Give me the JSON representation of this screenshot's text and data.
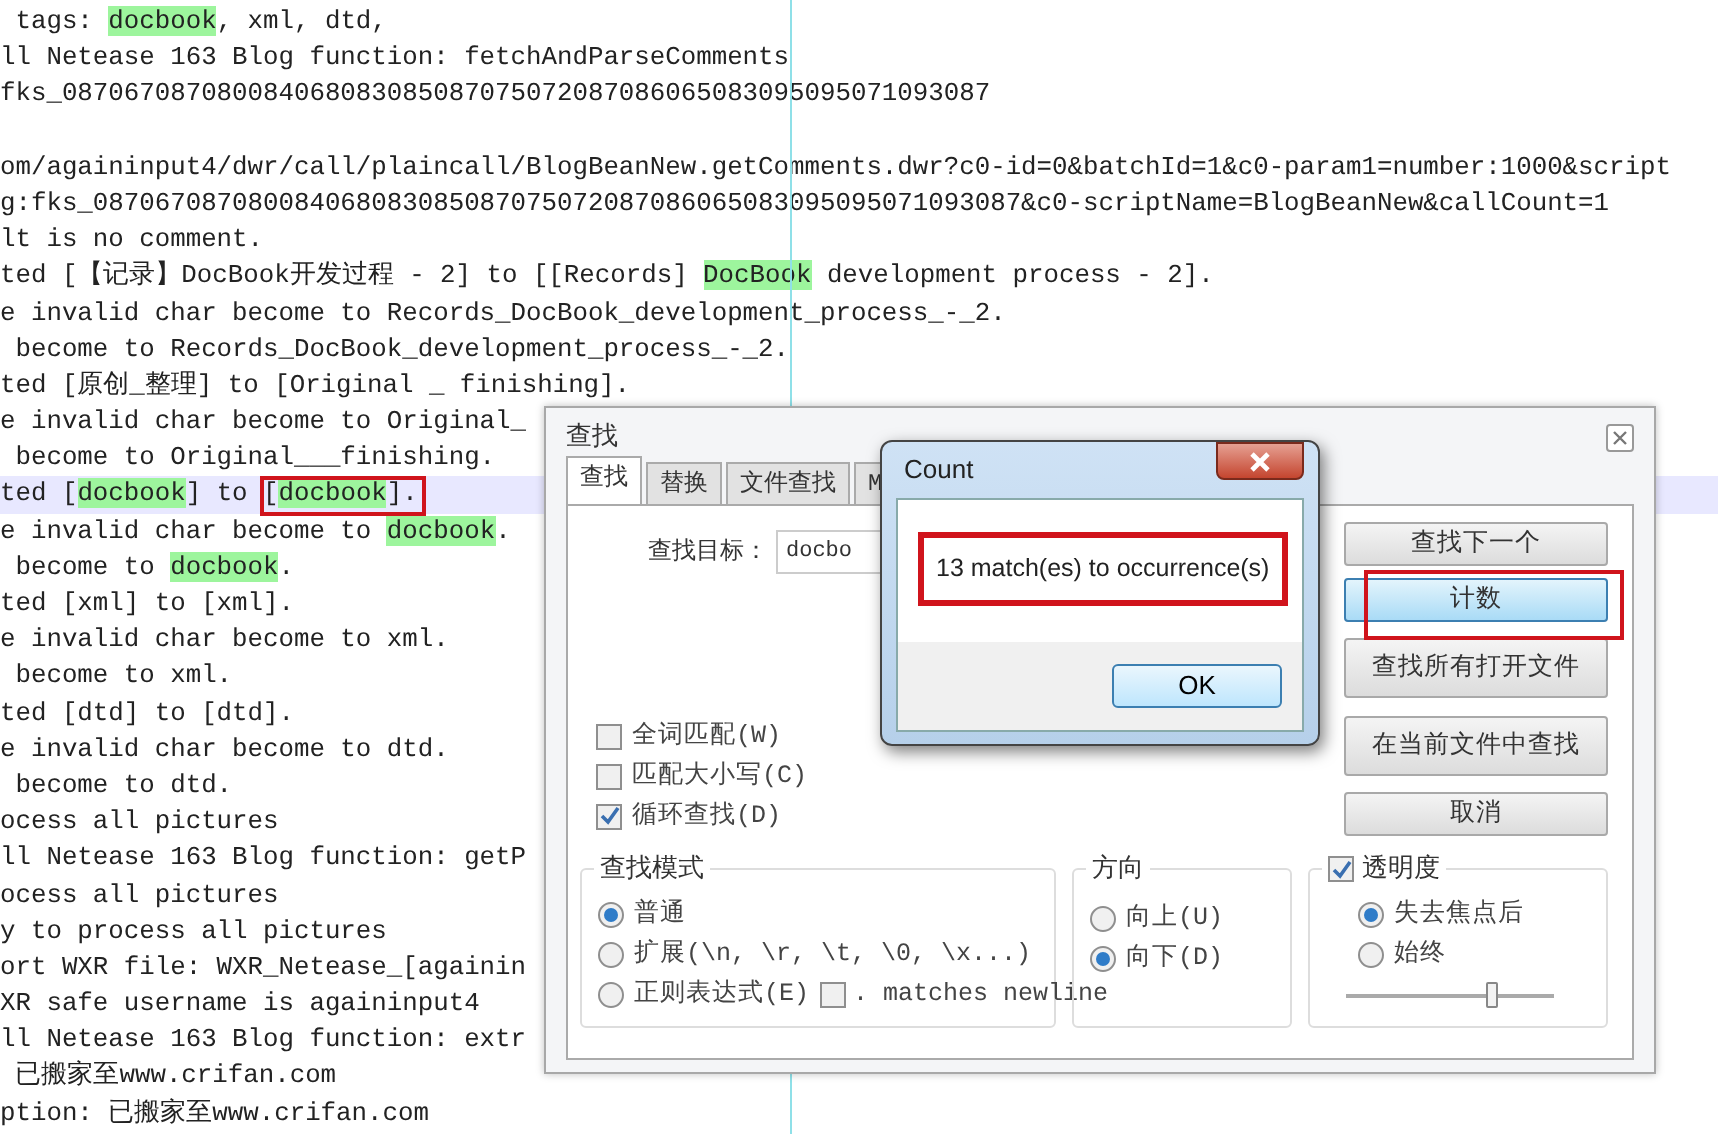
{
  "editor": {
    "lines": [
      {
        "segments": [
          {
            "text": " tags: ",
            "match": false
          },
          {
            "text": "docbook",
            "match": true
          },
          {
            "text": ", xml, dtd,",
            "match": false
          }
        ],
        "current": false
      },
      {
        "segments": [
          {
            "text": "ll Netease 163 Blog function: fetchAndParseComments",
            "match": false
          }
        ],
        "current": false
      },
      {
        "segments": [
          {
            "text": "fks_087067087080084068083085087075072087086065083095095071093087",
            "match": false
          }
        ],
        "current": false
      },
      {
        "current": false
      },
      {
        "segments": [
          {
            "text": "om/againinput4/dwr/call/plaincall/BlogBeanNew.getComments.dwr?c0-id=0&batchId=1&c0-param1=number:1000&script",
            "match": false
          }
        ],
        "current": false
      },
      {
        "segments": [
          {
            "text": "g:fks_087067087080084068083085087075072087086065083095095071093087&c0-scriptName=BlogBeanNew&callCount=1",
            "match": false
          }
        ],
        "current": false
      },
      {
        "segments": [
          {
            "text": "lt is no comment.",
            "match": false
          }
        ],
        "current": false
      },
      {
        "segments": [
          {
            "text": "ted [【记录】DocBook开发过程 - 2] to [[Records] ",
            "match": false
          },
          {
            "text": "DocBook",
            "match": true
          },
          {
            "text": " development process - 2].",
            "match": false
          }
        ],
        "current": false
      },
      {
        "segments": [
          {
            "text": "e invalid char become to Records_DocBook_development_process_-_2.",
            "match": false
          }
        ],
        "current": false
      },
      {
        "segments": [
          {
            "text": " become to Records_DocBook_development_process_-_2.",
            "match": false
          }
        ],
        "current": false
      },
      {
        "segments": [
          {
            "text": "ted [原创_整理] to [Original _ finishing].",
            "match": false
          }
        ],
        "current": false
      },
      {
        "segments": [
          {
            "text": "e invalid char become to Original_",
            "match": false
          }
        ],
        "current": false
      },
      {
        "segments": [
          {
            "text": " become to Original___finishing.",
            "match": false
          }
        ],
        "current": false
      },
      {
        "segments": [
          {
            "text": "ted [",
            "match": false
          },
          {
            "text": "docbook",
            "match": true
          },
          {
            "text": "] to [",
            "match": false
          },
          {
            "text": "docbook",
            "match": true
          },
          {
            "text": "].",
            "match": false
          }
        ],
        "current": true
      },
      {
        "segments": [
          {
            "text": "e invalid char become to ",
            "match": false
          },
          {
            "text": "docbook",
            "match": true
          },
          {
            "text": ".",
            "match": false
          }
        ],
        "current": false
      },
      {
        "segments": [
          {
            "text": " become to ",
            "match": false
          },
          {
            "text": "docbook",
            "match": true
          },
          {
            "text": ".",
            "match": false
          }
        ],
        "current": false
      },
      {
        "segments": [
          {
            "text": "ted [xml] to [xml].",
            "match": false
          }
        ],
        "current": false
      },
      {
        "segments": [
          {
            "text": "e invalid char become to xml.",
            "match": false
          }
        ],
        "current": false
      },
      {
        "segments": [
          {
            "text": " become to xml.",
            "match": false
          }
        ],
        "current": false
      },
      {
        "segments": [
          {
            "text": "ted [dtd] to [dtd].",
            "match": false
          }
        ],
        "current": false
      },
      {
        "segments": [
          {
            "text": "e invalid char become to dtd.",
            "match": false
          }
        ],
        "current": false
      },
      {
        "segments": [
          {
            "text": " become to dtd.",
            "match": false
          }
        ],
        "current": false
      },
      {
        "segments": [
          {
            "text": "ocess all pictures",
            "match": false
          }
        ],
        "current": false
      },
      {
        "segments": [
          {
            "text": "ll Netease 163 Blog function: getP",
            "match": false
          }
        ],
        "current": false
      },
      {
        "segments": [
          {
            "text": "ocess all pictures",
            "match": false
          }
        ],
        "current": false
      },
      {
        "segments": [
          {
            "text": "y to process all pictures",
            "match": false
          }
        ],
        "current": false
      },
      {
        "segments": [
          {
            "text": "ort WXR file: WXR_Netease_[againin",
            "match": false
          }
        ],
        "current": false
      },
      {
        "segments": [
          {
            "text": "XR safe username is againinput4",
            "match": false
          }
        ],
        "current": false
      },
      {
        "segments": [
          {
            "text": "ll Netease 163 Blog function: extr",
            "match": false
          }
        ],
        "current": false
      },
      {
        "segments": [
          {
            "text": " 已搬家至www.crifan.com",
            "match": false
          }
        ],
        "current": false
      },
      {
        "segments": [
          {
            "text": "ption: 已搬家至www.crifan.com",
            "match": false
          }
        ],
        "current": false
      }
    ]
  },
  "find_dialog": {
    "title": "查找",
    "tabs": [
      {
        "label": "查找",
        "selected": true
      },
      {
        "label": "替换",
        "selected": false
      },
      {
        "label": "文件查找",
        "selected": false
      },
      {
        "label": "M",
        "selected": false
      }
    ],
    "target_label": "查找目标：",
    "target_value": "docbo",
    "buttons": [
      {
        "label": "查找下一个",
        "focused": false
      },
      {
        "label": "计数",
        "focused": true
      },
      {
        "label": "查找所有打开文件",
        "focused": false
      },
      {
        "label": "在当前文件中查找",
        "focused": false
      },
      {
        "label": "取消",
        "focused": false
      }
    ],
    "options": [
      {
        "label": "全词匹配(W)",
        "checked": false
      },
      {
        "label": "匹配大小写(C)",
        "checked": false
      },
      {
        "label": "循环查找(D)",
        "checked": true
      }
    ],
    "search_mode": {
      "title": "查找模式",
      "options": [
        {
          "label": "普通",
          "selected": true
        },
        {
          "label": "扩展(\\n, \\r, \\t, \\0, \\x...)",
          "selected": false
        },
        {
          "label": "正则表达式(E)",
          "selected": false
        }
      ],
      "newline_option": {
        "label": ". matches newline",
        "checked": false
      }
    },
    "direction": {
      "title": "方向",
      "options": [
        {
          "label": "向上(U)",
          "selected": false
        },
        {
          "label": "向下(D)",
          "selected": true
        }
      ]
    },
    "transparency": {
      "label": "透明度",
      "checked": true,
      "options": [
        {
          "label": "失去焦点后",
          "selected": true
        },
        {
          "label": "始终",
          "selected": false
        }
      ],
      "level": 0.7
    }
  },
  "count_dialog": {
    "title": "Count",
    "message": "13 match(es) to occurrence(s)",
    "ok_label": "OK"
  }
}
